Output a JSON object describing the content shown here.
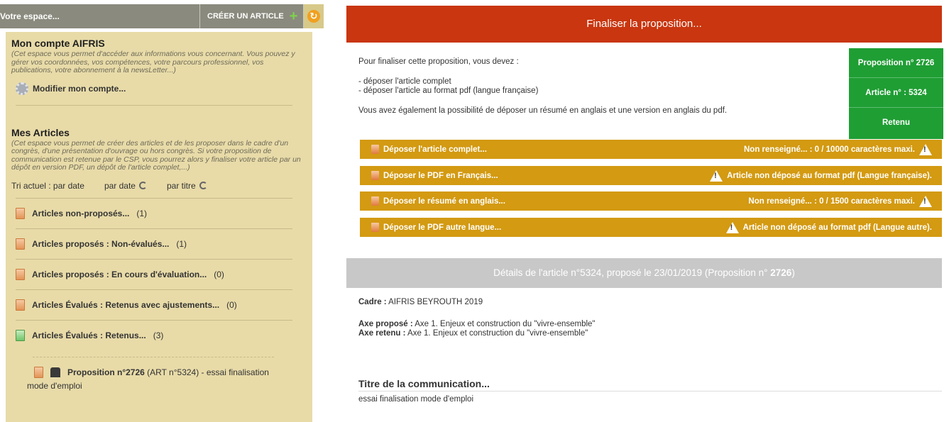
{
  "left": {
    "space_label": "Votre espace...",
    "create_article": "CRÉER UN ARTICLE",
    "account": {
      "title": "Mon compte AIFRIS",
      "desc": "(Cet espace vous permet d'accéder aux informations vous concernant. Vous pouvez y gérer vos coordonnées, vos compétences, votre parcours professionnel, vos publications, votre abonnement à la newsLetter...)",
      "modify": "Modifier mon compte..."
    },
    "articles": {
      "title": "Mes Articles",
      "desc": "(Cet espace vous permet de créer des articles et de les proposer dans le cadre d'un congrès, d'une présentation d'ouvrage ou hors congrès. Si votre proposition de communication est retenue par le CSP, vous pourrez alors y finaliser votre article par un dépôt en version PDF, un dépôt de l'article complet,...)",
      "sort_current": "Tri actuel : par date",
      "sort_date": "par date",
      "sort_title": "par titre",
      "items": [
        {
          "label": "Articles non-proposés...",
          "count": "(1)"
        },
        {
          "label": "Articles proposés : Non-évalués...",
          "count": "(1)"
        },
        {
          "label": "Articles proposés : En cours d'évaluation...",
          "count": "(0)"
        },
        {
          "label": "Articles Évalués : Retenus avec ajustements...",
          "count": "(0)"
        },
        {
          "label": "Articles Évalués : Retenus...",
          "count": "(3)"
        }
      ],
      "proposition": {
        "bold": "Proposition n°2726",
        "rest": " (ART n°5324) - essai finalisation",
        "cont": "mode d'emploi"
      }
    }
  },
  "right": {
    "header": "Finaliser la proposition...",
    "intro": {
      "line1": "Pour finaliser cette proposition, vous devez :",
      "line2": "- déposer l'article complet",
      "line3": "- déposer l'article au format pdf (langue française)",
      "line4": "Vous avez également la possibilité de déposer un résumé en anglais et une version en anglais du pdf."
    },
    "status": {
      "proposition": "Proposition n° 2726",
      "article": "Article n° : 5324",
      "state": "Retenu"
    },
    "deposits": [
      {
        "label": "Déposer l'article complet...",
        "status": "Non renseigné... : 0 / 10000 caractères maxi."
      },
      {
        "label": "Déposer le PDF en Français...",
        "status": "Article non déposé au format pdf (Langue française)."
      },
      {
        "label": "Déposer le résumé en anglais...",
        "status": "Non renseigné... : 0 / 1500 caractères maxi."
      },
      {
        "label": "Déposer le PDF autre langue...",
        "status": "Article non déposé au format pdf (Langue autre)."
      }
    ],
    "details": {
      "text": "Détails de l'article n°5324, proposé le 23/01/2019 (Proposition n° ",
      "num": "2726",
      "close": ")"
    },
    "cadre_key": "Cadre :",
    "cadre_val": " AIFRIS BEYROUTH 2019",
    "axe_prop_key": "Axe proposé :",
    "axe_prop_val": " Axe 1. Enjeux et construction du \"vivre-ensemble\"",
    "axe_ret_key": "Axe retenu :",
    "axe_ret_val": " Axe 1. Enjeux et construction du \"vivre-ensemble\"",
    "title_heading": "Titre de la communication...",
    "title_value": "essai finalisation mode d'emploi"
  }
}
